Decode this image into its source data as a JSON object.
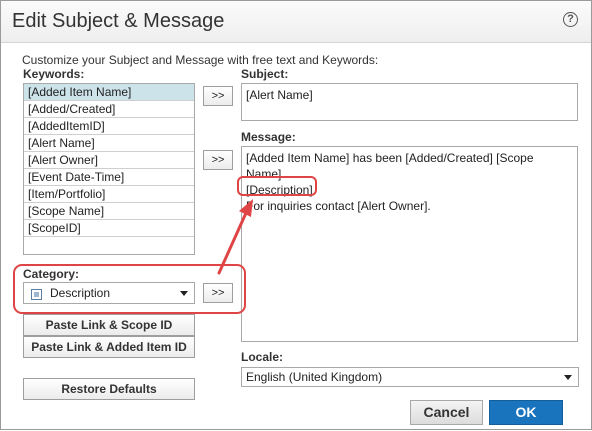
{
  "dialog": {
    "title": "Edit Subject & Message",
    "help_icon": "?",
    "intro": "Customize your Subject and Message with free text and Keywords:"
  },
  "keywords": {
    "label": "Keywords:",
    "items": [
      "[Added Item Name]",
      "[Added/Created]",
      "[AddedItemID]",
      "[Alert Name]",
      "[Alert Owner]",
      "[Event Date-Time]",
      "[Item/Portfolio]",
      "[Scope Name]",
      "[ScopeID]"
    ],
    "selected_index": 0
  },
  "category": {
    "label": "Category:",
    "value": "Description"
  },
  "buttons": {
    "insert_subject": ">>",
    "insert_message": ">>",
    "insert_category": ">>",
    "paste_link_scope": "Paste Link & Scope ID",
    "paste_link_item": "Paste Link & Added Item ID",
    "restore_defaults": "Restore Defaults",
    "cancel": "Cancel",
    "ok": "OK"
  },
  "subject": {
    "label": "Subject:",
    "value": "[Alert Name]"
  },
  "message": {
    "label": "Message:",
    "line1": "[Added Item Name] has been [Added/Created] [Scope",
    "line2": "Name].",
    "line3": "[Description]",
    "line4": "For inquiries contact [Alert Owner]."
  },
  "locale": {
    "label": "Locale:",
    "value": "English (United Kingdom)"
  },
  "colors": {
    "accent": "#1a74bd",
    "highlight": "#e04545",
    "selected_row": "#cde3ea"
  }
}
